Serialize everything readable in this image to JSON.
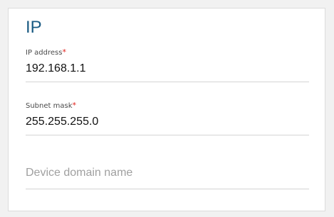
{
  "section": {
    "title": "IP"
  },
  "fields": {
    "ip_address": {
      "label": "IP address",
      "required_marker": "*",
      "value": "192.168.1.1"
    },
    "subnet_mask": {
      "label": "Subnet mask",
      "required_marker": "*",
      "value": "255.255.255.0"
    },
    "device_domain_name": {
      "placeholder": "Device domain name",
      "value": ""
    }
  },
  "colors": {
    "title": "#1a5b83",
    "required": "#e0201a",
    "underline": "#d4d4d4",
    "placeholder": "#a0a0a0"
  }
}
